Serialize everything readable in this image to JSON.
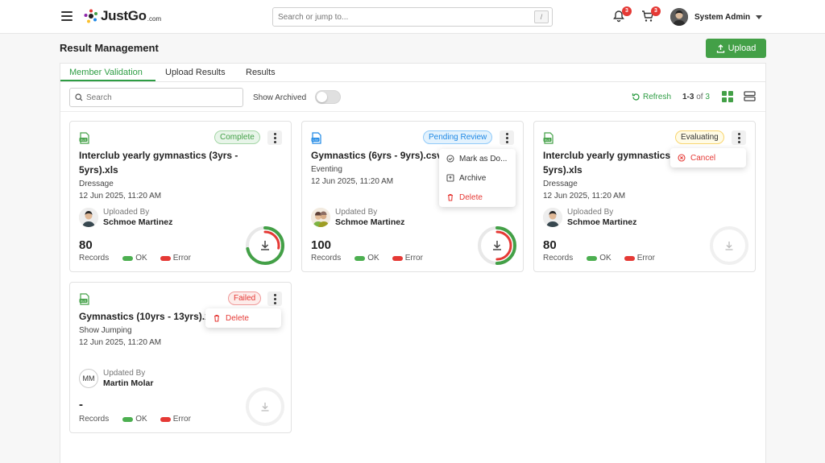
{
  "header": {
    "logo_text": "JustGo",
    "logo_suffix": ".com",
    "search_placeholder": "Search or jump to...",
    "search_shortcut": "/",
    "notifications_count": "3",
    "cart_count": "3",
    "user_name": "System Admin"
  },
  "page": {
    "title": "Result Management",
    "upload_label": "Upload"
  },
  "tabs": [
    {
      "label": "Member Validation",
      "active": true
    },
    {
      "label": "Upload Results",
      "active": false
    },
    {
      "label": "Results",
      "active": false
    }
  ],
  "toolbar": {
    "search_placeholder": "Search",
    "show_archived_label": "Show Archived",
    "show_archived_on": false,
    "refresh_label": "Refresh",
    "range_text": "1-3",
    "of_text": "of",
    "total_text": "3"
  },
  "cards": [
    {
      "file_type": "XLS",
      "status": "Complete",
      "title": "Interclub yearly gymnastics (3yrs -\n5yrs).xls",
      "category": "Dressage",
      "date": "12 Jun 2025, 11:20 AM",
      "updated_by_label": "Uploaded By",
      "updated_by": "Schmoe Martinez",
      "records": "80",
      "records_label": "Records",
      "ok_label": "OK",
      "error_label": "Error",
      "ok_fraction": 0.72,
      "error_fraction": 0.28
    },
    {
      "file_type": "CSV",
      "status": "Pending Review",
      "title": "Gymnastics (6yrs - 9yrs).csv",
      "category": "Eventing",
      "date": "12 Jun 2025, 11:20 AM",
      "updated_by_label": "Updated By",
      "updated_by": "Schmoe Martinez",
      "records": "100",
      "records_label": "Records",
      "ok_label": "OK",
      "error_label": "Error",
      "ok_fraction": 0.5,
      "error_fraction": 0.5,
      "menu": [
        "Mark as Do...",
        "Archive",
        "Delete"
      ]
    },
    {
      "file_type": "XLS",
      "status": "Evaluating",
      "title": "Interclub yearly gymnastics (3yrs -\n5yrs).xls",
      "category": "Dressage",
      "date": "12 Jun 2025, 11:20 AM",
      "updated_by_label": "Uploaded By",
      "updated_by": "Schmoe Martinez",
      "records": "80",
      "records_label": "Records",
      "ok_label": "OK",
      "error_label": "Error",
      "menu": [
        "Cancel"
      ]
    },
    {
      "file_type": "XLS",
      "status": "Failed",
      "title": "Gymnastics (10yrs - 13yrs).xls",
      "category": "Show Jumping",
      "date": "12 Jun 2025, 11:20 AM",
      "updated_by_label": "Updated By",
      "updated_by": "Martin Molar",
      "updated_by_initials": "MM",
      "records": "-",
      "records_label": "Records",
      "ok_label": "OK",
      "error_label": "Error",
      "menu": [
        "Delete"
      ]
    }
  ],
  "colors": {
    "brand_green": "#43a047",
    "error_red": "#e53935",
    "pending_blue": "#1e88e5"
  }
}
